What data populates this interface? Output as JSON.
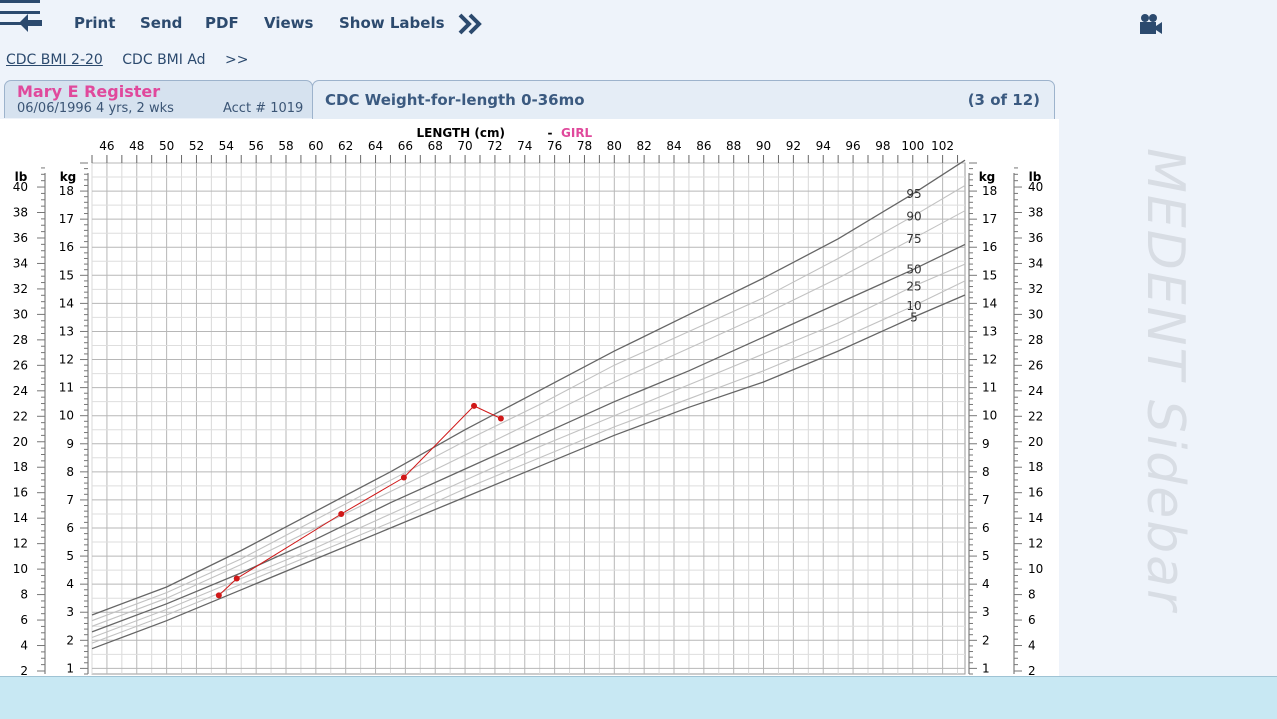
{
  "toolbar": {
    "back_icon": "back-arrow-icon",
    "print_label": "Print",
    "send_label": "Send",
    "pdf_label": "PDF",
    "views_label": "Views",
    "show_labels_label": "Show Labels",
    "more_icon": "double-chevron-right-icon",
    "camera_icon": "video-camera-icon",
    "menu_icon": "hamburger-menu-icon"
  },
  "subtabs": {
    "items": [
      "CDC BMI 2-20",
      "CDC BMI Ad",
      ">>"
    ]
  },
  "patient": {
    "name": "Mary E Register",
    "dob_age": "06/06/1996   4 yrs, 2 wks",
    "acct": "Acct # 1019"
  },
  "chart_tab": {
    "title": "CDC Weight-for-length 0-36mo",
    "count": "(3 of 12)"
  },
  "sidebar": {
    "watermark": "MEDENT Sidebar"
  },
  "colors": {
    "accent_pink": "#e0499c",
    "toolbar_text": "#2c4a6e",
    "status_bar": "#c8e8f3",
    "patient_points": "#d01818"
  },
  "chart_data": {
    "type": "line",
    "xlabel": "LENGTH (cm)",
    "xlabel_sep": "-",
    "sex_label": "GIRL",
    "x_ticks": [
      46,
      48,
      50,
      52,
      54,
      56,
      58,
      60,
      62,
      64,
      66,
      68,
      70,
      72,
      74,
      76,
      78,
      80,
      82,
      84,
      86,
      88,
      90,
      92,
      94,
      96,
      98,
      100,
      102
    ],
    "xlim": [
      45,
      103.5
    ],
    "ylim_kg": [
      0.8,
      19
    ],
    "kg_ticks": [
      1,
      2,
      3,
      4,
      5,
      6,
      7,
      8,
      9,
      10,
      11,
      12,
      13,
      14,
      15,
      16,
      17,
      18
    ],
    "lb_ticks": [
      2,
      4,
      6,
      8,
      10,
      12,
      14,
      16,
      18,
      20,
      22,
      24,
      26,
      28,
      30,
      32,
      34,
      36,
      38,
      40
    ],
    "left_unit_lb": "lb",
    "left_unit_kg": "kg",
    "right_unit_kg": "kg",
    "right_unit_lb": "lb",
    "grid": true,
    "percentile_x": [
      45,
      50,
      55,
      60,
      65,
      70,
      75,
      80,
      85,
      90,
      95,
      100,
      103.5
    ],
    "series": [
      {
        "name": "95",
        "values": [
          2.9,
          3.9,
          5.2,
          6.6,
          8.0,
          9.5,
          10.9,
          12.3,
          13.6,
          14.9,
          16.3,
          17.9,
          19.1
        ]
      },
      {
        "name": "90",
        "values": [
          2.7,
          3.7,
          4.9,
          6.3,
          7.7,
          9.1,
          10.4,
          11.8,
          13.0,
          14.2,
          15.6,
          17.1,
          18.2
        ]
      },
      {
        "name": "75",
        "values": [
          2.5,
          3.5,
          4.7,
          6.0,
          7.3,
          8.6,
          9.9,
          11.2,
          12.4,
          13.6,
          14.9,
          16.3,
          17.3
        ]
      },
      {
        "name": "50",
        "values": [
          2.3,
          3.3,
          4.4,
          5.6,
          6.9,
          8.1,
          9.3,
          10.5,
          11.6,
          12.8,
          14.0,
          15.2,
          16.1
        ]
      },
      {
        "name": "25",
        "values": [
          2.1,
          3.1,
          4.2,
          5.3,
          6.5,
          7.7,
          8.9,
          10.0,
          11.1,
          12.2,
          13.3,
          14.6,
          15.4
        ]
      },
      {
        "name": "10",
        "values": [
          1.9,
          2.9,
          4.0,
          5.1,
          6.2,
          7.4,
          8.5,
          9.6,
          10.6,
          11.6,
          12.7,
          13.9,
          14.8
        ]
      },
      {
        "name": "5",
        "values": [
          1.7,
          2.7,
          3.8,
          4.9,
          6.0,
          7.1,
          8.2,
          9.3,
          10.3,
          11.2,
          12.3,
          13.5,
          14.3
        ]
      }
    ],
    "patient_points": [
      {
        "x": 53.5,
        "y": 3.6
      },
      {
        "x": 54.7,
        "y": 4.2
      },
      {
        "x": 61.7,
        "y": 6.5
      },
      {
        "x": 65.9,
        "y": 7.8
      },
      {
        "x": 70.6,
        "y": 10.35
      },
      {
        "x": 72.4,
        "y": 9.9
      }
    ]
  }
}
